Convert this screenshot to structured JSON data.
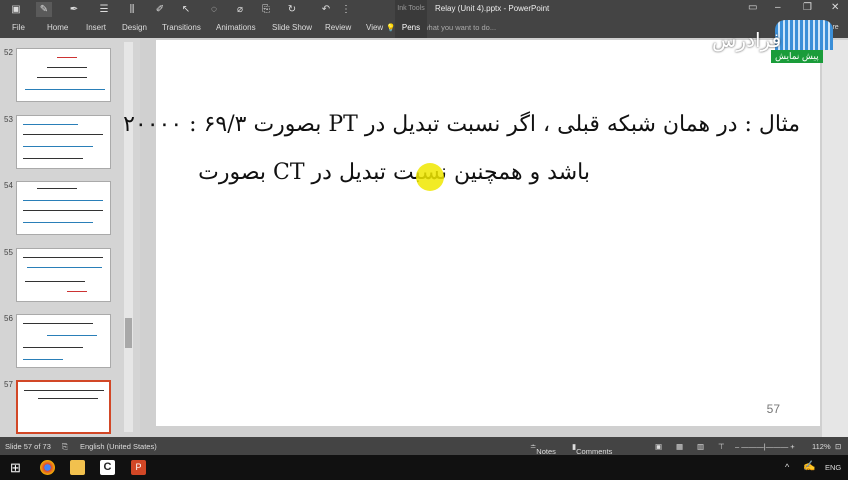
{
  "window": {
    "title": "Relay (Unit 4).pptx - PowerPoint",
    "contextual_group": "Ink Tools"
  },
  "ribbon": {
    "tabs": [
      "File",
      "Home",
      "Insert",
      "Design",
      "Transitions",
      "Animations",
      "Slide Show",
      "Review",
      "View",
      "Pens"
    ],
    "tell_me": "Tell me what you want to do...",
    "share": "Share"
  },
  "thumbnails": [
    {
      "number": "52"
    },
    {
      "number": "53"
    },
    {
      "number": "54"
    },
    {
      "number": "55"
    },
    {
      "number": "56"
    },
    {
      "number": "57"
    }
  ],
  "slide": {
    "line1": "مثال : در همان شبکه قبلی ، اگر نسبت تبدیل در PT بصورت ۶۹/۳ : ۲۰۰۰۰",
    "line2": "باشد و همچنین نسبت تبدیل در CT بصورت",
    "page_number": "57"
  },
  "status": {
    "slide": "Slide 57 of 73",
    "language": "English (United States)",
    "notes": "Notes",
    "comments": "Comments",
    "zoom": "112%"
  },
  "taskbar": {
    "language": "ENG"
  },
  "watermark": {
    "brand": "فرادرس",
    "badge": "پیش نمایش"
  }
}
